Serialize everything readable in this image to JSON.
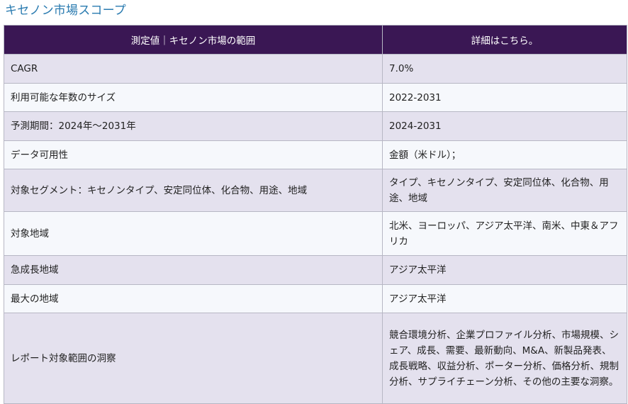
{
  "page": {
    "title": "キセノン市場スコープ"
  },
  "table": {
    "headers": [
      "測定値｜キセノン市場の範囲",
      "詳細はこちら。"
    ],
    "rows": [
      {
        "label": "CAGR",
        "value": "7.0%"
      },
      {
        "label": "利用可能な年数のサイズ",
        "value": "2022-2031"
      },
      {
        "label": "予測期間：2024年～2031年",
        "value": "2024-2031"
      },
      {
        "label": "データ可用性",
        "value": "金額（米ドル）；"
      },
      {
        "label": "対象セグメント：キセノンタイプ、安定同位体、化合物、用途、地域",
        "value": "タイプ、キセノンタイプ、安定同位体、化合物、用途、地域"
      },
      {
        "label": "対象地域",
        "value": "北米、ヨーロッパ、アジア太平洋、南米、中東＆アフリカ"
      },
      {
        "label": "急成長地域",
        "value": "アジア太平洋"
      },
      {
        "label": "最大の地域",
        "value": "アジア太平洋"
      },
      {
        "label": "レポート対象範囲の洞察",
        "value": "競合環境分析、企業プロファイル分析、市場規模、シェア、成長、需要、最新動向、M&A、新製品発表、成長戦略、収益分析、ポーター分析、価格分析、規制分析、サプライチェーン分析、その他の主要な洞察。"
      }
    ]
  },
  "colors": {
    "title": "#2a7bb0",
    "header_bg": "#3a1754",
    "row_odd_bg": "#e4e1ee",
    "row_even_bg": "#f6f8fc"
  }
}
